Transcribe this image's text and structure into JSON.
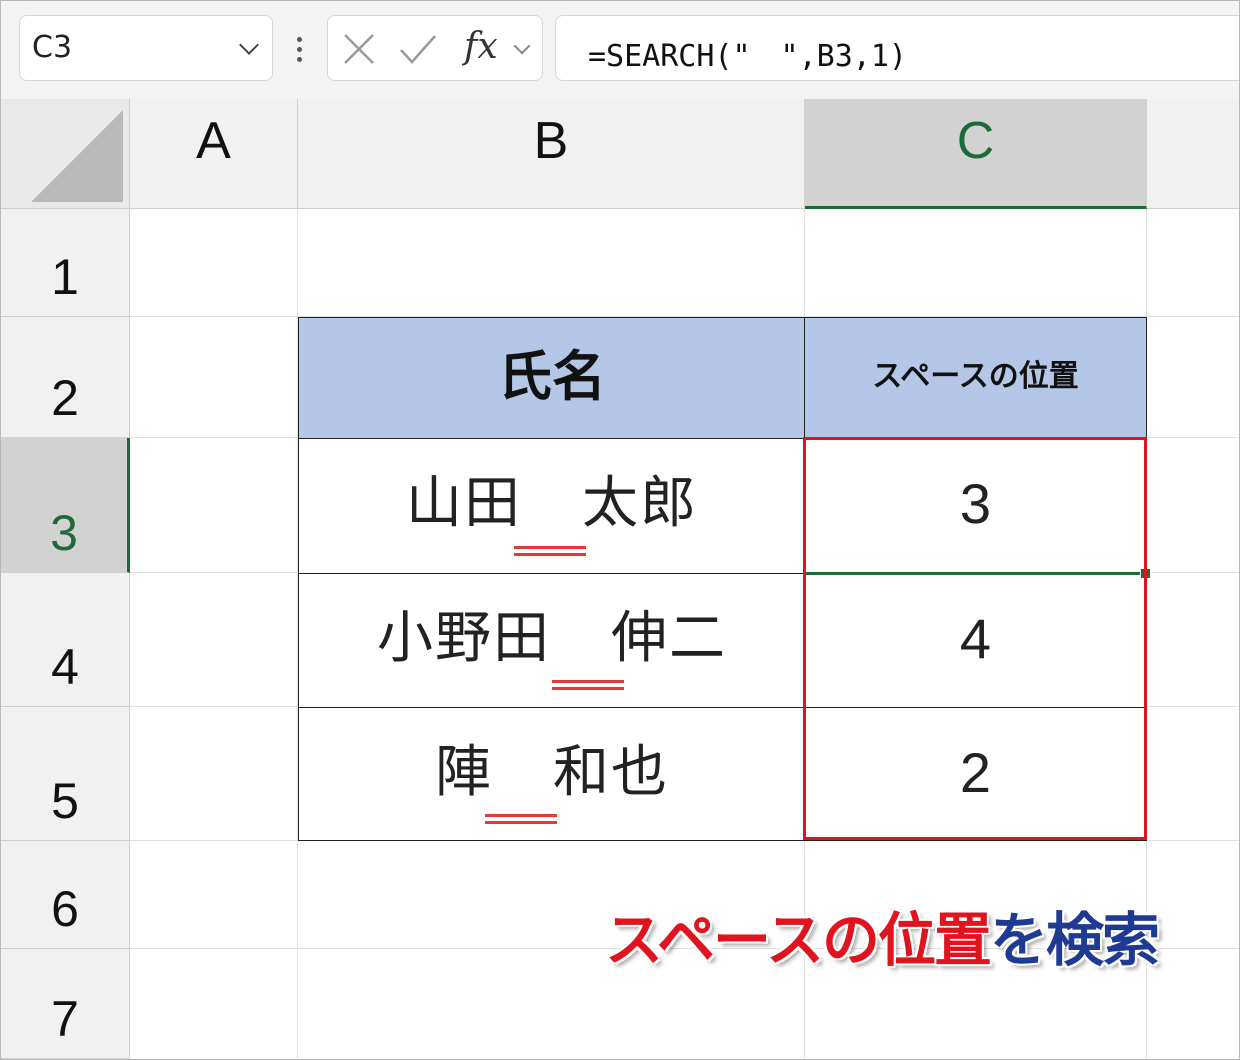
{
  "formula_bar": {
    "name_box": "C3",
    "formula": "=SEARCH(\"　\",B3,1)",
    "icons": [
      "chevron-down-icon",
      "grip-icon",
      "cancel-icon",
      "enter-icon",
      "fx-icon"
    ]
  },
  "columns": [
    "A",
    "B",
    "C"
  ],
  "rows": [
    "1",
    "2",
    "3",
    "4",
    "5",
    "6",
    "7"
  ],
  "table": {
    "headers": [
      "氏名",
      "スペースの位置"
    ],
    "rows": [
      {
        "name_left": "山田",
        "name_right": "太郎",
        "position": "3"
      },
      {
        "name_left": "小野田",
        "name_right": "伸二",
        "position": "4"
      },
      {
        "name_left": "陣",
        "name_right": "和也",
        "position": "2"
      }
    ]
  },
  "caption": {
    "part1": "スペースの位置",
    "part2": "を検索",
    "color1": "#e0141e",
    "color2": "#1f3a93"
  },
  "colors": {
    "header_fill": "#b4c7e7",
    "selection_green": "#1e6b3a",
    "highlight_red": "#e0141e"
  }
}
